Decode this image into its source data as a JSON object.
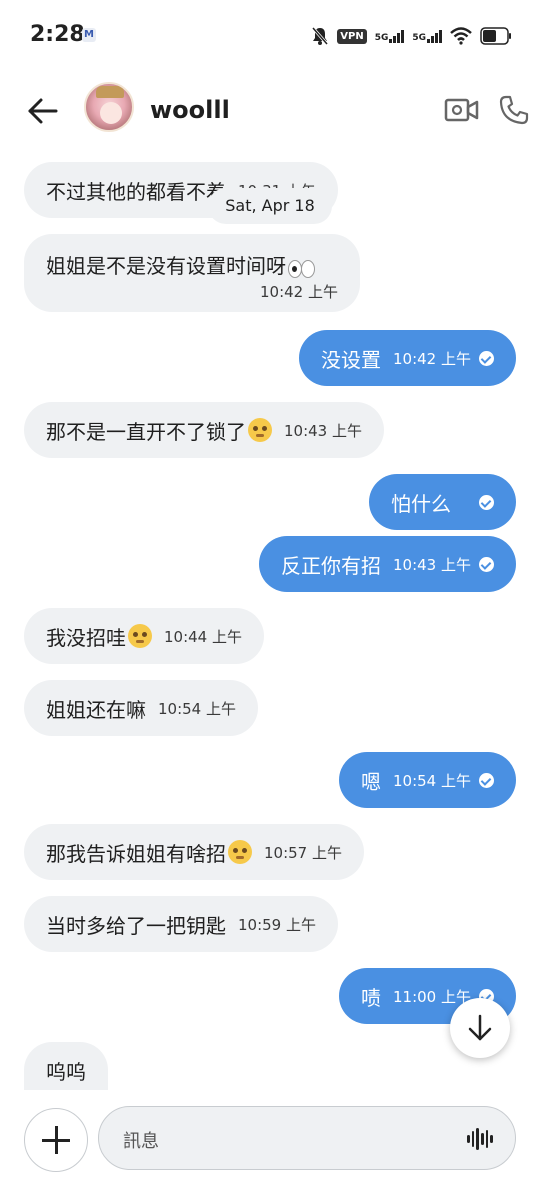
{
  "status_bar": {
    "time": "2:28",
    "mail_icon": "M",
    "vpn": "VPN",
    "net1": "5G",
    "net2": "5G"
  },
  "header": {
    "contact_name": "woolll"
  },
  "date_chip": "Sat, Apr 18",
  "messages": [
    {
      "dir": "in",
      "text": "不过其他的都看不着",
      "time": "10:31 上午"
    },
    {
      "dir": "in",
      "text": "姐姐是不是没有设置时间呀",
      "time": "10:42 上午"
    },
    {
      "dir": "out",
      "text": "没设置",
      "time": "10:42 上午"
    },
    {
      "dir": "in",
      "text": "那不是一直开不了锁了",
      "time": "10:43 上午"
    },
    {
      "dir": "out",
      "text": "怕什么",
      "time": ""
    },
    {
      "dir": "out",
      "text": "反正你有招",
      "time": "10:43 上午"
    },
    {
      "dir": "in",
      "text": "我没招哇",
      "time": "10:44 上午"
    },
    {
      "dir": "in",
      "text": "姐姐还在嘛",
      "time": "10:54 上午"
    },
    {
      "dir": "out",
      "text": "嗯",
      "time": "10:54 上午"
    },
    {
      "dir": "in",
      "text": "那我告诉姐姐有啥招",
      "time": "10:57 上午"
    },
    {
      "dir": "in",
      "text": "当时多给了一把钥匙",
      "time": "10:59 上午"
    },
    {
      "dir": "out",
      "text": "啧",
      "time": "11:00 上午"
    },
    {
      "dir": "in",
      "text": "呜呜",
      "time": ""
    }
  ],
  "composer": {
    "placeholder": "訊息"
  },
  "colors": {
    "outgoing_bubble": "#4a90e2",
    "incoming_bubble": "#eff1f3"
  },
  "icons": [
    "back-arrow-icon",
    "video-call-icon",
    "phone-icon",
    "read-check-icon",
    "scroll-down-arrow-icon",
    "plus-icon",
    "voice-waveform-icon"
  ]
}
